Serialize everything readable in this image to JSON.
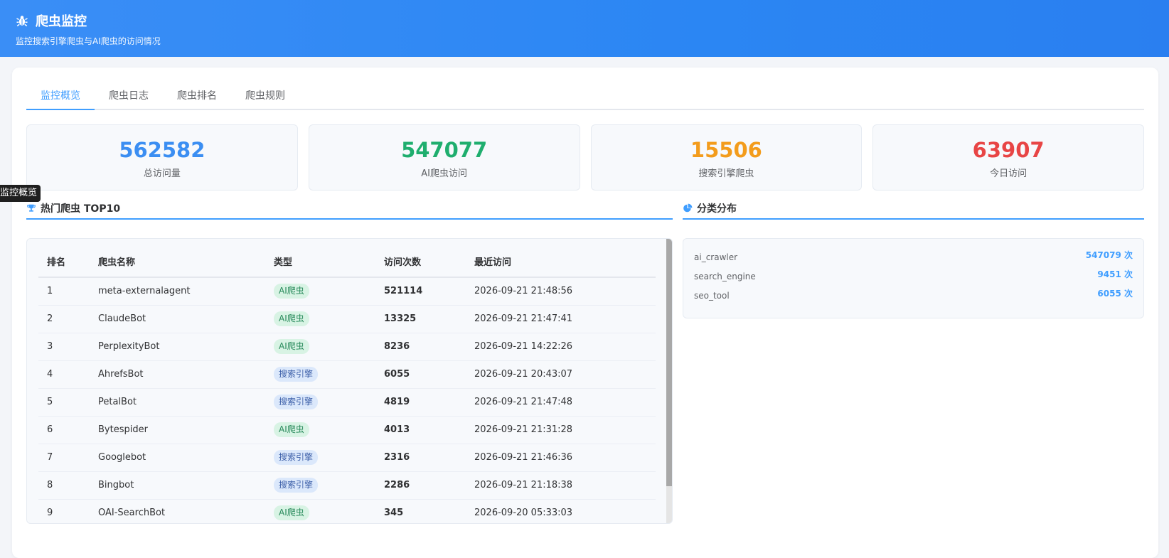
{
  "header": {
    "title": "爬虫监控",
    "subtitle": "监控搜索引擎爬虫与AI爬虫的访问情况"
  },
  "tabs": [
    {
      "label": "监控概览"
    },
    {
      "label": "爬虫日志"
    },
    {
      "label": "爬虫排名"
    },
    {
      "label": "爬虫规则"
    }
  ],
  "tooltip": "监控概览",
  "stats": [
    {
      "value": "562582",
      "label": "总访问量",
      "color": "#3b8ef2"
    },
    {
      "value": "547077",
      "label": "AI爬虫访问",
      "color": "#1fae6e"
    },
    {
      "value": "15506",
      "label": "搜索引擎爬虫",
      "color": "#f39c1c"
    },
    {
      "value": "63907",
      "label": "今日访问",
      "color": "#e84545"
    }
  ],
  "top10": {
    "title": "热门爬虫 TOP10",
    "columns": [
      "排名",
      "爬虫名称",
      "类型",
      "访问次数",
      "最近访问"
    ],
    "rows": [
      {
        "rank": "1",
        "name": "meta-externalagent",
        "type": "AI爬虫",
        "kind": "ai",
        "count": "521114",
        "last": "2026-09-21 21:48:56"
      },
      {
        "rank": "2",
        "name": "ClaudeBot",
        "type": "AI爬虫",
        "kind": "ai",
        "count": "13325",
        "last": "2026-09-21 21:47:41"
      },
      {
        "rank": "3",
        "name": "PerplexityBot",
        "type": "AI爬虫",
        "kind": "ai",
        "count": "8236",
        "last": "2026-09-21 14:22:26"
      },
      {
        "rank": "4",
        "name": "AhrefsBot",
        "type": "搜索引擎",
        "kind": "se",
        "count": "6055",
        "last": "2026-09-21 20:43:07"
      },
      {
        "rank": "5",
        "name": "PetalBot",
        "type": "搜索引擎",
        "kind": "se",
        "count": "4819",
        "last": "2026-09-21 21:47:48"
      },
      {
        "rank": "6",
        "name": "Bytespider",
        "type": "AI爬虫",
        "kind": "ai",
        "count": "4013",
        "last": "2026-09-21 21:31:28"
      },
      {
        "rank": "7",
        "name": "Googlebot",
        "type": "搜索引擎",
        "kind": "se",
        "count": "2316",
        "last": "2026-09-21 21:46:36"
      },
      {
        "rank": "8",
        "name": "Bingbot",
        "type": "搜索引擎",
        "kind": "se",
        "count": "2286",
        "last": "2026-09-21 21:18:38"
      },
      {
        "rank": "9",
        "name": "OAI-SearchBot",
        "type": "AI爬虫",
        "kind": "ai",
        "count": "345",
        "last": "2026-09-20 05:33:03"
      }
    ]
  },
  "distribution": {
    "title": "分类分布",
    "items": [
      {
        "name": "ai_crawler",
        "count": "547079 次"
      },
      {
        "name": "search_engine",
        "count": "9451 次"
      },
      {
        "name": "seo_tool",
        "count": "6055 次"
      }
    ]
  }
}
